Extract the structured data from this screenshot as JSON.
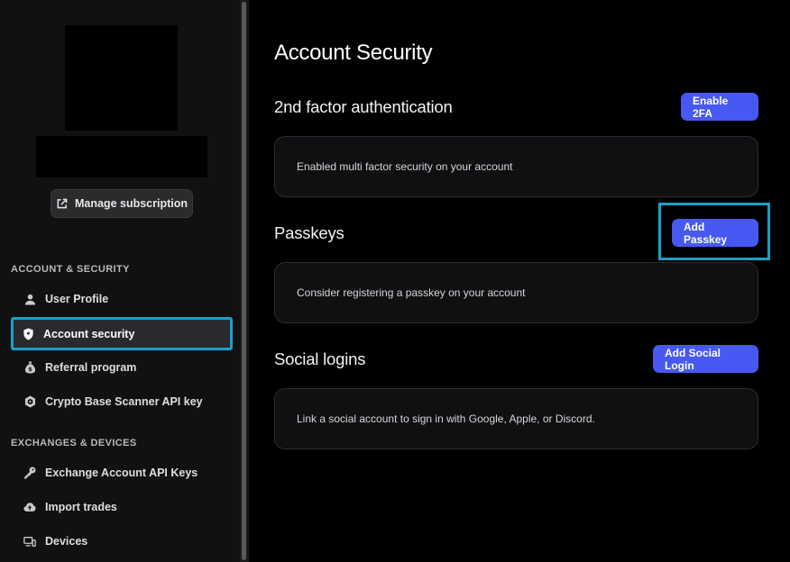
{
  "sidebar": {
    "manage_subscription": "Manage subscription",
    "sections": [
      {
        "label": "ACCOUNT & SECURITY",
        "items": [
          {
            "label": "User Profile",
            "icon": "user-icon"
          },
          {
            "label": "Account security",
            "icon": "shield-icon",
            "active": true
          },
          {
            "label": "Referral program",
            "icon": "money-bag-icon"
          },
          {
            "label": "Crypto Base Scanner API key",
            "icon": "hexagon-icon"
          }
        ]
      },
      {
        "label": "EXCHANGES & DEVICES",
        "items": [
          {
            "label": "Exchange Account API Keys",
            "icon": "key-icon"
          },
          {
            "label": "Import trades",
            "icon": "cloud-upload-icon"
          },
          {
            "label": "Devices",
            "icon": "devices-icon"
          }
        ]
      }
    ]
  },
  "main": {
    "title": "Account Security",
    "sections": [
      {
        "title": "2nd factor authentication",
        "button": "Enable 2FA",
        "card_text": "Enabled multi factor security on your account"
      },
      {
        "title": "Passkeys",
        "button": "Add Passkey",
        "card_text": "Consider registering a passkey on your account"
      },
      {
        "title": "Social logins",
        "button": "Add Social Login",
        "card_text": "Link a social account to sign in with Google, Apple, or Discord."
      }
    ]
  },
  "colors": {
    "accent": "#4759f2",
    "highlight": "#1aa0c7",
    "sidebar_bg": "#111112",
    "main_bg": "#000000"
  }
}
